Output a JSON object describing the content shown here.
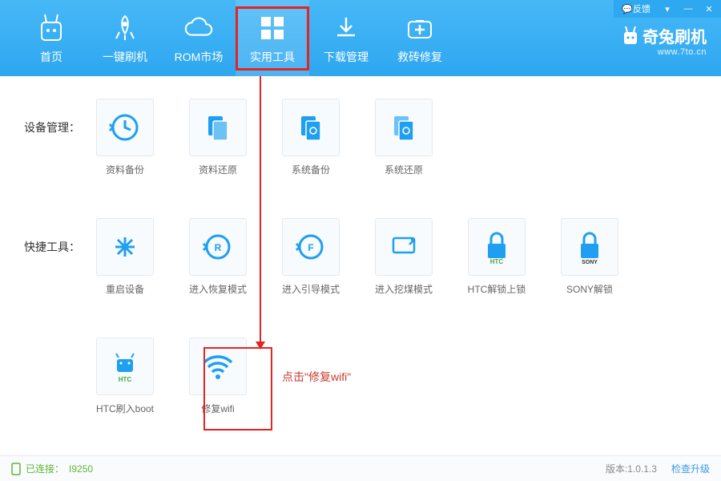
{
  "titlebar": {
    "feedback": "反馈"
  },
  "brand": {
    "name": "奇兔刷机",
    "url": "www.7to.cn"
  },
  "nav": {
    "items": [
      {
        "label": "首页"
      },
      {
        "label": "一键刷机"
      },
      {
        "label": "ROM市场"
      },
      {
        "label": "实用工具"
      },
      {
        "label": "下载管理"
      },
      {
        "label": "救砖修复"
      }
    ],
    "active_index": 3
  },
  "sections": {
    "device_mgmt": {
      "label": "设备管理：",
      "tiles": [
        {
          "label": "资料备份"
        },
        {
          "label": "资料还原"
        },
        {
          "label": "系统备份"
        },
        {
          "label": "系统还原"
        }
      ]
    },
    "quick_tools": {
      "label": "快捷工具：",
      "tiles": [
        {
          "label": "重启设备"
        },
        {
          "label": "进入恢复模式"
        },
        {
          "label": "进入引导模式"
        },
        {
          "label": "进入挖煤模式"
        },
        {
          "label": "HTC解锁上锁"
        },
        {
          "label": "SONY解锁"
        }
      ]
    },
    "extra": {
      "label": "",
      "tiles": [
        {
          "label": "HTC刷入boot"
        },
        {
          "label": "修复wifi"
        }
      ]
    }
  },
  "annotation": {
    "wifi_hint": "点击\"修复wifi\""
  },
  "status": {
    "connected_prefix": "已连接：",
    "device": "I9250",
    "version_label": "版本:1.0.1.3",
    "check_update": "检查升级"
  }
}
